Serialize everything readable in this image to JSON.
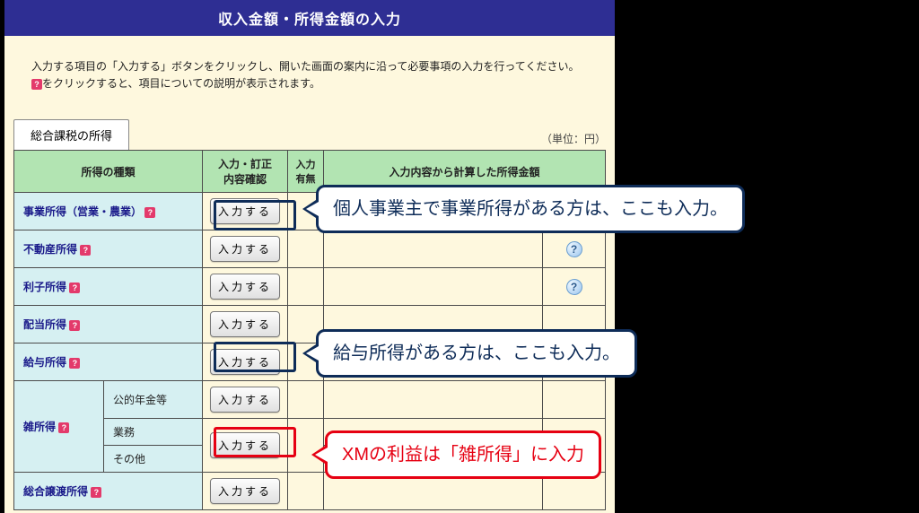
{
  "header": {
    "title": "収入金額・所得金額の入力"
  },
  "instructions": {
    "line1": "入力する項目の「入力する」ボタンをクリックし、開いた画面の案内に沿って必要事項の入力を行ってください。",
    "line2_after_icon": "をクリックすると、項目についての説明が表示されます。"
  },
  "tab": {
    "label": "総合課税の所得"
  },
  "unit": "（単位：円）",
  "table": {
    "head": {
      "col1": "所得の種類",
      "col2": "入力・訂正\n内容確認",
      "col3": "入力\n有無",
      "col4": "入力内容から計算した所得金額"
    },
    "rows": [
      {
        "label": "事業所得（営業・農業）",
        "help": true,
        "btn": "入力する"
      },
      {
        "label": "不動産所得",
        "help": true,
        "btn": "入力する",
        "q": true
      },
      {
        "label": "利子所得",
        "help": true,
        "btn": "入力する",
        "q": true
      },
      {
        "label": "配当所得",
        "help": true,
        "btn": "入力する"
      },
      {
        "label": "給与所得",
        "help": true,
        "btn": "入力する"
      }
    ],
    "misc": {
      "group": "雑所得",
      "sub": [
        {
          "label": "公的年金等",
          "btn": "入力する"
        },
        {
          "label": "業務"
        },
        {
          "label": "その他",
          "btn": "入力する"
        }
      ]
    },
    "last": {
      "label": "総合譲渡所得",
      "help": true,
      "btn": "入力する"
    }
  },
  "callouts": {
    "c1": "個人事業主で事業所得がある方は、ここも入力。",
    "c2": "給与所得がある方は、ここも入力。",
    "c3": "XMの利益は「雑所得」に入力"
  }
}
